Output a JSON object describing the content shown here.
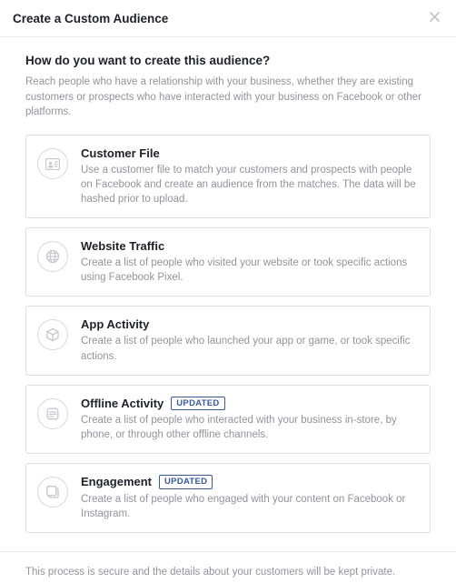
{
  "header": {
    "title": "Create a Custom Audience"
  },
  "content": {
    "question": "How do you want to create this audience?",
    "subtext": "Reach people who have a relationship with your business, whether they are existing customers or prospects who have interacted with your business on Facebook or other platforms."
  },
  "badges": {
    "updated": "UPDATED"
  },
  "options": [
    {
      "key": "customer-file",
      "title": "Customer File",
      "desc": "Use a customer file to match your customers and prospects with people on Facebook and create an audience from the matches. The data will be hashed prior to upload.",
      "updated": false
    },
    {
      "key": "website-traffic",
      "title": "Website Traffic",
      "desc": "Create a list of people who visited your website or took specific actions using Facebook Pixel.",
      "updated": false
    },
    {
      "key": "app-activity",
      "title": "App Activity",
      "desc": "Create a list of people who launched your app or game, or took specific actions.",
      "updated": false
    },
    {
      "key": "offline-activity",
      "title": "Offline Activity",
      "desc": "Create a list of people who interacted with your business in-store, by phone, or through other offline channels.",
      "updated": true
    },
    {
      "key": "engagement",
      "title": "Engagement",
      "desc": "Create a list of people who engaged with your content on Facebook or Instagram.",
      "updated": true
    }
  ],
  "footer": {
    "privacy": "This process is secure and the details about your customers will be kept private."
  }
}
